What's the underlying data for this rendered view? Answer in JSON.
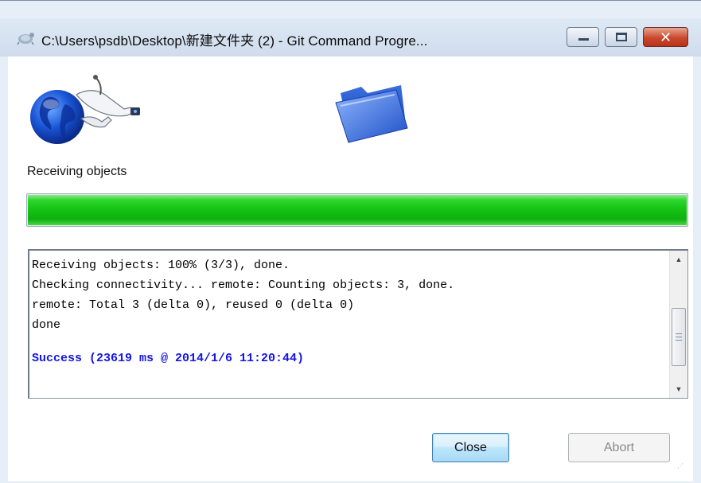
{
  "window": {
    "title": "C:\\Users\\psdb\\Desktop\\新建文件夹 (2) - Git Command Progre...",
    "icons": {
      "app": "git-tortoise-icon",
      "minimize": "minimize-icon",
      "maximize": "maximize-icon",
      "close": "close-icon"
    },
    "close_glyph": "✕"
  },
  "header": {
    "left_icon": "globe-network-icon",
    "right_icon": "folder-icon",
    "status_label": "Receiving objects"
  },
  "progress": {
    "value_percent": 100,
    "color": "#14c214"
  },
  "log": {
    "lines": [
      "Receiving objects: 100% (3/3), done.",
      "Checking connectivity... remote: Counting objects: 3, done.",
      "remote: Total 3 (delta 0), reused 0 (delta 0)",
      "done"
    ],
    "success_line": "Success (23619 ms @ 2014/1/6 11:20:44)",
    "success_color": "#1414e6",
    "scroll_up_glyph": "▲",
    "scroll_down_glyph": "▼"
  },
  "buttons": {
    "close_label": "Close",
    "abort_label": "Abort",
    "abort_enabled": false
  }
}
